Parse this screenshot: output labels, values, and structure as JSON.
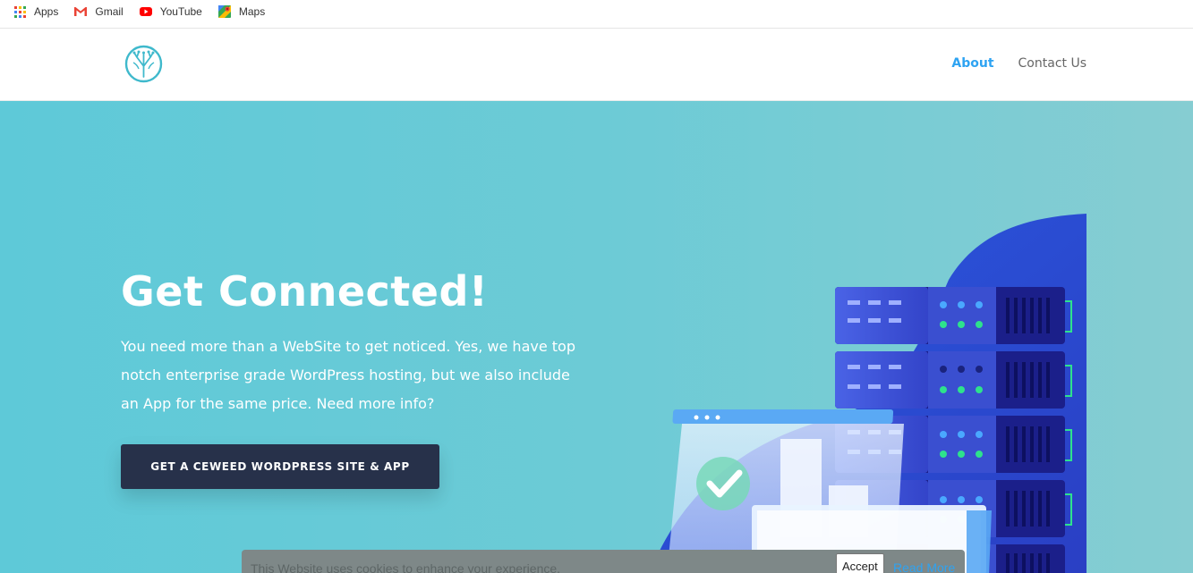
{
  "bookmarks": [
    {
      "label": "Apps",
      "icon": "apps-grid-icon"
    },
    {
      "label": "Gmail",
      "icon": "gmail-icon"
    },
    {
      "label": "YouTube",
      "icon": "youtube-icon"
    },
    {
      "label": "Maps",
      "icon": "maps-icon"
    }
  ],
  "nav": {
    "items": [
      {
        "label": "About",
        "active": true
      },
      {
        "label": "Contact Us",
        "active": false
      }
    ]
  },
  "hero": {
    "title": "Get Connected!",
    "text": "You need more than a WebSite to get noticed.  Yes, we have top notch enterprise grade WordPress hosting, but we also include an App for the same price.  Need more info?",
    "button": "GET A CEWEED WORDPRESS SITE & APP"
  },
  "cookie": {
    "text": "This Website uses cookies to enhance your experience.",
    "accept": "Accept",
    "read_more": "Read More"
  },
  "colors": {
    "accent": "#2ea3f2",
    "button_bg": "#27314a",
    "hero_bg": "#6ccbd6"
  }
}
